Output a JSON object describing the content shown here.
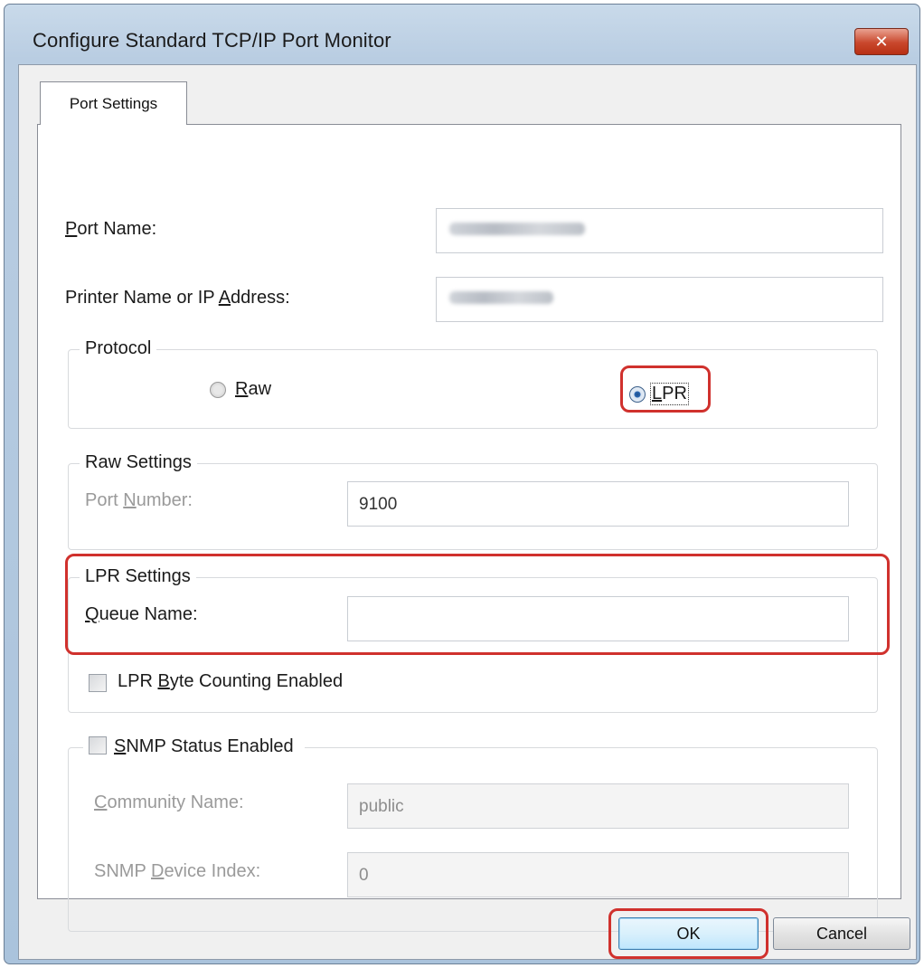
{
  "window": {
    "title": "Configure Standard TCP/IP Port Monitor",
    "close_glyph": "✕"
  },
  "tabs": [
    {
      "label": "Port Settings",
      "active": true
    }
  ],
  "fields": {
    "port_name": {
      "label_first": "P",
      "label_rest": "ort Name:",
      "value": ""
    },
    "printer_address": {
      "label_before": "Printer Name or IP ",
      "label_accel": "A",
      "label_after": "ddress:",
      "value": ""
    }
  },
  "protocol": {
    "title": "Protocol",
    "options": [
      {
        "accel": "R",
        "rest": "aw",
        "selected": false
      },
      {
        "accel": "L",
        "rest": "PR",
        "selected": true
      }
    ]
  },
  "raw_settings": {
    "title": "Raw Settings",
    "port_number": {
      "label_before": "Port ",
      "label_accel": "N",
      "label_after": "umber:",
      "value": "9100",
      "enabled": false
    }
  },
  "lpr_settings": {
    "title": "LPR Settings",
    "queue_name": {
      "label_accel": "Q",
      "label_rest": "ueue Name:",
      "value": ""
    },
    "byte_counting": {
      "label_before": "LPR ",
      "label_accel": "B",
      "label_after": "yte Counting Enabled",
      "checked": false
    }
  },
  "snmp": {
    "enabled_checkbox": {
      "label_accel": "S",
      "label_rest": "NMP Status Enabled",
      "checked": false
    },
    "community_name": {
      "label_accel": "C",
      "label_rest": "ommunity Name:",
      "value": "public",
      "enabled": false
    },
    "device_index": {
      "label_before": "SNMP ",
      "label_accel": "D",
      "label_after": "evice Index:",
      "value": "0",
      "enabled": false
    }
  },
  "buttons": {
    "ok": "OK",
    "cancel": "Cancel"
  },
  "colors": {
    "highlight": "#d0312d",
    "title_bar": "#b9cde2",
    "close_button": "#c9472c"
  }
}
